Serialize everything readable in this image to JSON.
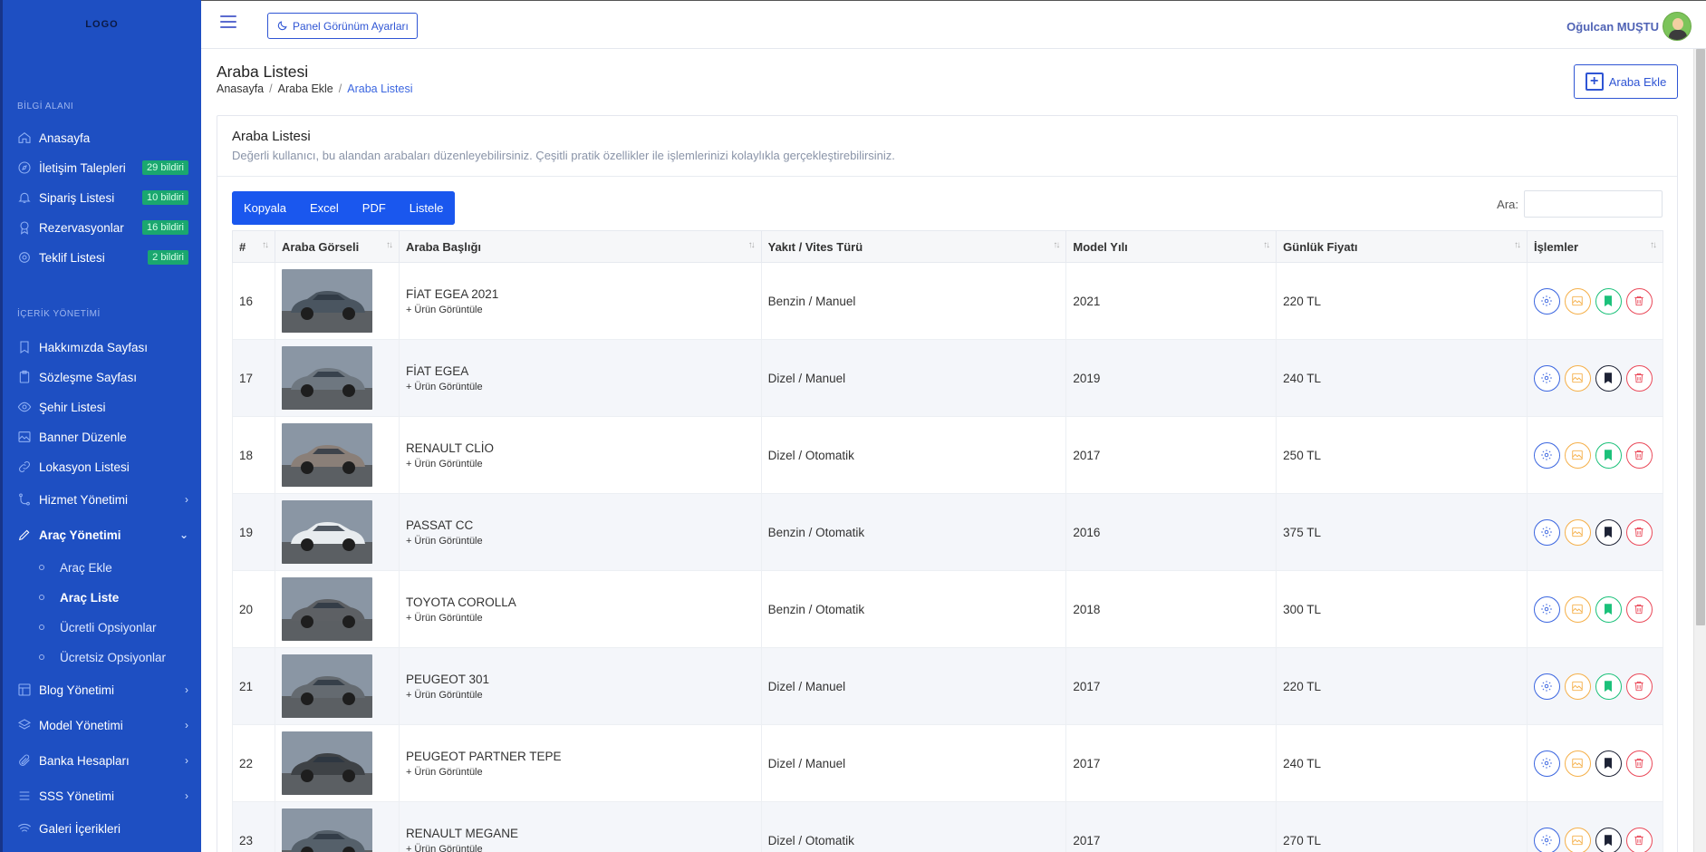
{
  "sidebar": {
    "logo": "LOGO",
    "section_info": "BİLGİ ALANI",
    "section_content": "İÇERİK YÖNETİMİ",
    "items": [
      {
        "label": "Anasayfa",
        "icon": "home-icon"
      },
      {
        "label": "İletişim Talepleri",
        "badge": "29 bildiri",
        "icon": "compass-icon"
      },
      {
        "label": "Sipariş Listesi",
        "badge": "10 bildiri",
        "icon": "bell-icon"
      },
      {
        "label": "Rezervasyonlar",
        "badge": "16 bildiri",
        "icon": "award-icon"
      },
      {
        "label": "Teklif Listesi",
        "badge": "2 bildiri",
        "icon": "settings-icon"
      },
      {
        "label": "Hakkımızda Sayfası",
        "icon": "bookmark-icon"
      },
      {
        "label": "Sözleşme Sayfası",
        "icon": "clipboard-icon"
      },
      {
        "label": "Şehir Listesi",
        "icon": "eye-icon"
      },
      {
        "label": "Banner Düzenle",
        "icon": "image-icon"
      },
      {
        "label": "Lokasyon Listesi",
        "icon": "link-icon"
      },
      {
        "label": "Hizmet Yönetimi",
        "icon": "git-icon"
      },
      {
        "label": "Araç Yönetimi",
        "icon": "pen-icon"
      },
      {
        "label": "Blog Yönetimi",
        "icon": "layout-icon"
      },
      {
        "label": "Model Yönetimi",
        "icon": "layers-icon"
      },
      {
        "label": "Banka Hesapları",
        "icon": "paperclip-icon"
      },
      {
        "label": "SSS Yönetimi",
        "icon": "list-icon"
      },
      {
        "label": "Galeri İçerikleri",
        "icon": "wifi-icon"
      }
    ],
    "sub_items": [
      {
        "label": "Araç Ekle"
      },
      {
        "label": "Araç Liste"
      },
      {
        "label": "Ücretli Opsiyonlar"
      },
      {
        "label": "Ücretsiz Opsiyonlar"
      }
    ]
  },
  "topbar": {
    "panel_button": "Panel Görünüm Ayarları",
    "user_name": "Oğulcan MUŞTU"
  },
  "page": {
    "title": "Araba Listesi",
    "breadcrumb": [
      "Anasayfa",
      "Araba Ekle",
      "Araba Listesi"
    ],
    "add_button": "Araba Ekle"
  },
  "card": {
    "title": "Araba Listesi",
    "description": "Değerli kullanıcı, bu alandan arabaları düzenleyebilirsiniz. Çeşitli pratik özellikler ile işlemlerinizi kolaylıkla gerçekleştirebilirsiniz.",
    "buttons": [
      "Kopyala",
      "Excel",
      "PDF",
      "Listele"
    ],
    "search_label": "Ara:",
    "search_value": ""
  },
  "table": {
    "columns": [
      "#",
      "Araba Görseli",
      "Araba Başlığı",
      "Yakıt / Vites Türü",
      "Model Yılı",
      "Günlük Fiyatı",
      "İşlemler"
    ],
    "view_link": "+ Ürün Görüntüle",
    "rows": [
      {
        "id": "16",
        "title": "FİAT EGEA 2021",
        "fuel": "Benzin / Manuel",
        "year": "2021",
        "price": "220 TL",
        "featured": true,
        "car_color": "#4a5560"
      },
      {
        "id": "17",
        "title": "FİAT EGEA",
        "fuel": "Dizel / Manuel",
        "year": "2019",
        "price": "240 TL",
        "featured": false,
        "car_color": "#6e7780"
      },
      {
        "id": "18",
        "title": "RENAULT CLİO",
        "fuel": "Dizel / Otomatik",
        "year": "2017",
        "price": "250 TL",
        "featured": true,
        "car_color": "#8a7f78"
      },
      {
        "id": "19",
        "title": "PASSAT CC",
        "fuel": "Benzin / Otomatik",
        "year": "2016",
        "price": "375 TL",
        "featured": false,
        "car_color": "#e8ecef"
      },
      {
        "id": "20",
        "title": "TOYOTA COROLLA",
        "fuel": "Benzin / Otomatik",
        "year": "2018",
        "price": "300 TL",
        "featured": true,
        "car_color": "#5d6064"
      },
      {
        "id": "21",
        "title": "PEUGEOT 301",
        "fuel": "Dizel / Manuel",
        "year": "2017",
        "price": "220 TL",
        "featured": true,
        "car_color": "#646a70"
      },
      {
        "id": "22",
        "title": "PEUGEOT PARTNER TEPE",
        "fuel": "Dizel / Manuel",
        "year": "2017",
        "price": "240 TL",
        "featured": false,
        "car_color": "#3e4246"
      },
      {
        "id": "23",
        "title": "RENAULT MEGANE",
        "fuel": "Dizel / Otomatik",
        "year": "2017",
        "price": "270 TL",
        "featured": false,
        "car_color": "#55606a"
      }
    ]
  },
  "colors": {
    "sidebar_bg": "#1e4fc2",
    "primary": "#1a57ee",
    "badge": "#1aa76f",
    "action_config": "#3b66e0",
    "action_image": "#f5b04a",
    "action_featured": "#1bc17a",
    "action_delete": "#ea4a5a"
  }
}
